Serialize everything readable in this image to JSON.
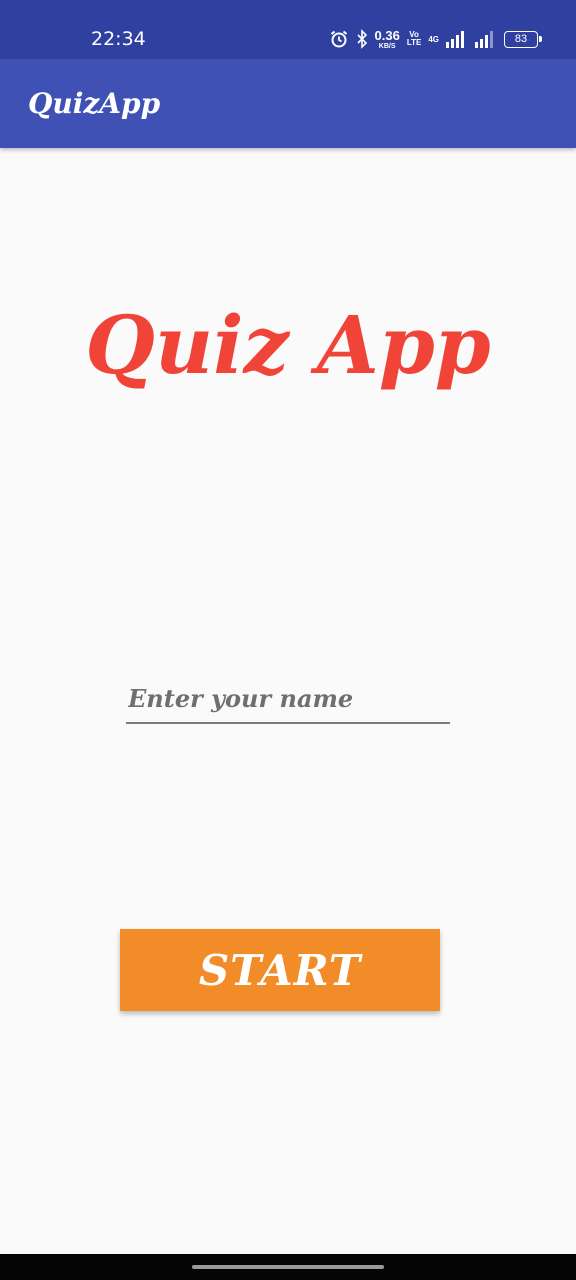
{
  "status_bar": {
    "time": "22:34",
    "net_speed_value": "0.36",
    "net_speed_unit": "KB/S",
    "volte_top": "Vo",
    "volte_bottom": "LTE",
    "net_type": "4G",
    "battery": "83",
    "icons": [
      "alarm-icon",
      "bluetooth-icon",
      "signal-icon",
      "signal-icon"
    ]
  },
  "app_bar": {
    "title": "QuizApp"
  },
  "heading": "Quiz App",
  "name_input": {
    "placeholder": "Enter your name",
    "value": ""
  },
  "start_button": {
    "label": "START"
  },
  "colors": {
    "status_bar": "#3040a0",
    "app_bar": "#3f51b5",
    "heading": "#f04438",
    "button": "#f28c28",
    "background": "#fafafa"
  }
}
